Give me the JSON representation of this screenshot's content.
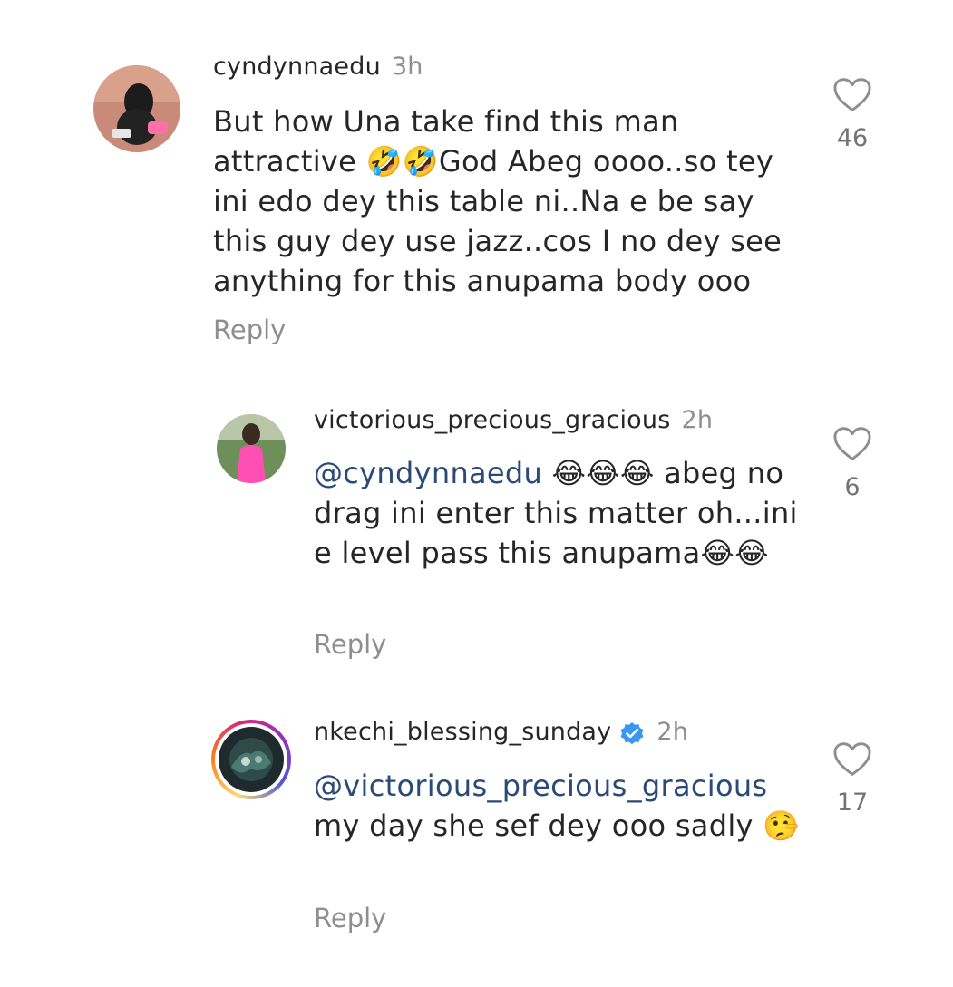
{
  "comments": [
    {
      "username": "cyndynnaedu",
      "time": "3h",
      "text": "But how Una take find this man attractive 🤣🤣God Abeg oooo..so tey ini edo dey this table ni..Na e be say this guy dey use jazz..cos I no dey see anything for this anupama body ooo",
      "reply": "Reply",
      "likes": "46"
    },
    {
      "username": "victorious_precious_gracious",
      "time": "2h",
      "mention": "@cyndynnaedu",
      "text_after_mention": " 😂😂😂 abeg no drag ini enter this matter oh...ini e level pass this anupama😂😂",
      "reply": "Reply",
      "likes": "6"
    },
    {
      "username": "nkechi_blessing_sunday",
      "time": "2h",
      "verified": true,
      "mention": "@victorious_precious_gracious",
      "text_after_mention": " my day she sef dey ooo sadly 🤥",
      "reply": "Reply",
      "likes": "17"
    }
  ],
  "icons": {
    "like": "heart-outline-icon",
    "verified": "verified-badge-icon"
  },
  "colors": {
    "verified": "#3897f0",
    "mention": "#2a4a78",
    "secondary": "#8e8e8e"
  }
}
